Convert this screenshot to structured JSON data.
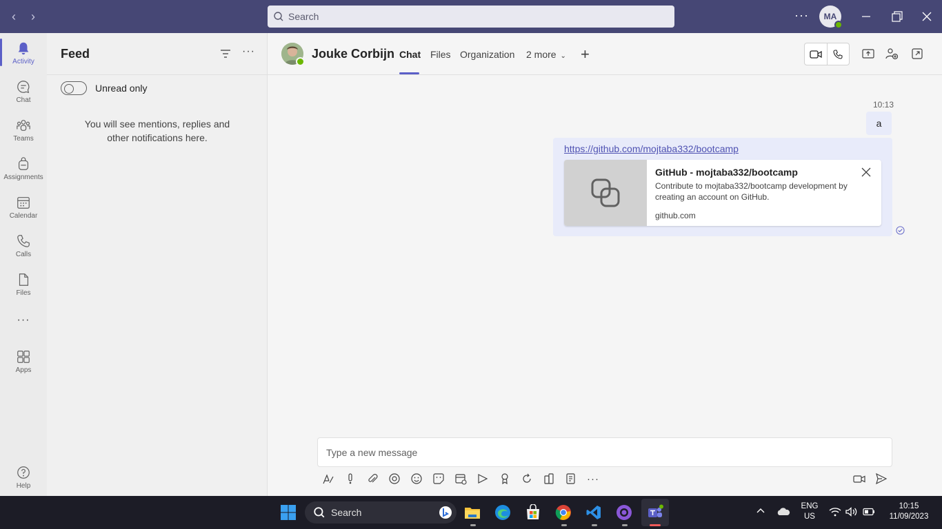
{
  "titlebar": {
    "search_placeholder": "Search",
    "avatar_initials": "MA"
  },
  "rail": {
    "items": [
      {
        "label": "Activity",
        "icon": "bell-icon",
        "active": true
      },
      {
        "label": "Chat",
        "icon": "chat-icon"
      },
      {
        "label": "Teams",
        "icon": "teams-icon"
      },
      {
        "label": "Assignments",
        "icon": "backpack-icon"
      },
      {
        "label": "Calendar",
        "icon": "calendar-icon"
      },
      {
        "label": "Calls",
        "icon": "phone-icon"
      },
      {
        "label": "Files",
        "icon": "file-icon"
      },
      {
        "label": "Apps",
        "icon": "apps-icon"
      },
      {
        "label": "Help",
        "icon": "help-icon"
      }
    ]
  },
  "feed": {
    "title": "Feed",
    "toggle_label": "Unread only",
    "empty_message": "You will see mentions, replies and other notifications here."
  },
  "chat": {
    "contact_name": "Jouke Corbijn",
    "tabs": [
      "Chat",
      "Files",
      "Organization",
      "2 more"
    ],
    "active_tab": "Chat",
    "messages": [
      {
        "time": "10:13",
        "text": "a"
      },
      {
        "link": "https://github.com/mojtaba332/bootcamp",
        "preview": {
          "title": "GitHub - mojtaba332/bootcamp",
          "description": "Contribute to mojtaba332/bootcamp development by creating an account on GitHub.",
          "domain": "github.com"
        }
      }
    ],
    "compose_placeholder": "Type a new message"
  },
  "taskbar": {
    "search_label": "Search",
    "language": "ENG",
    "region": "US",
    "time": "10:15",
    "date": "11/09/2023"
  },
  "colors": {
    "titlebar": "#464775",
    "accent": "#5b5fc7",
    "bubble": "#e8ebfa",
    "presence": "#6bb700"
  }
}
